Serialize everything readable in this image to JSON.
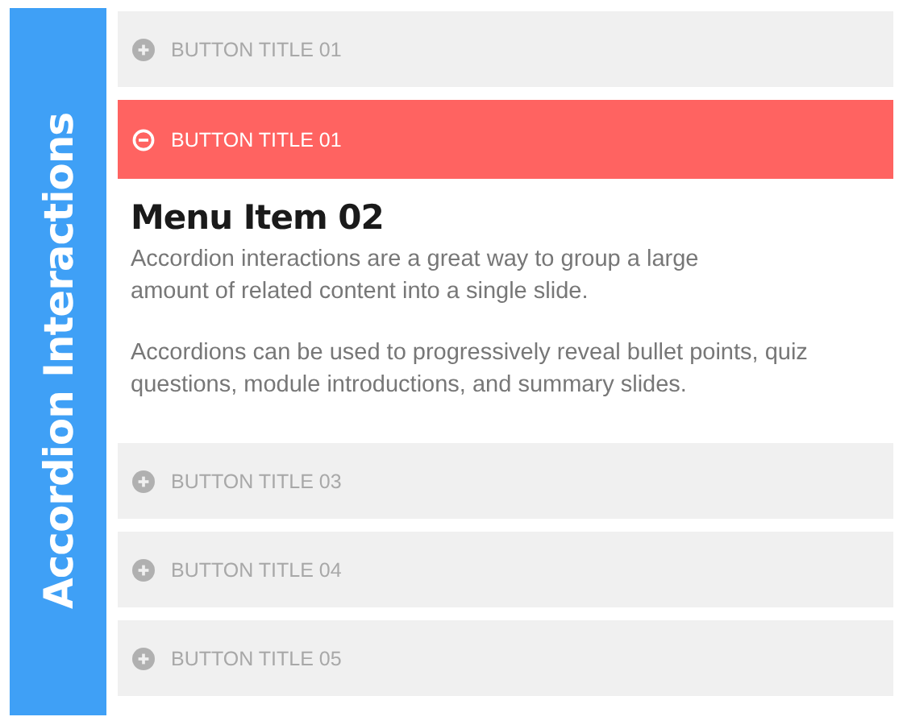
{
  "sidebar": {
    "title": "Accordion Interactions"
  },
  "accordion": [
    {
      "label": "BUTTON TITLE 01",
      "expanded": false
    },
    {
      "label": "BUTTON TITLE 01",
      "expanded": true,
      "heading": "Menu Item 02",
      "paragraphs": [
        "Accordion interactions are a great way to group a large amount of related content into a single slide.",
        "Accordions can be used to progressively reveal bullet points, quiz questions, module introductions, and summary slides."
      ]
    },
    {
      "label": "BUTTON TITLE 03",
      "expanded": false
    },
    {
      "label": "BUTTON TITLE 04",
      "expanded": false
    },
    {
      "label": "BUTTON TITLE 05",
      "expanded": false
    }
  ]
}
